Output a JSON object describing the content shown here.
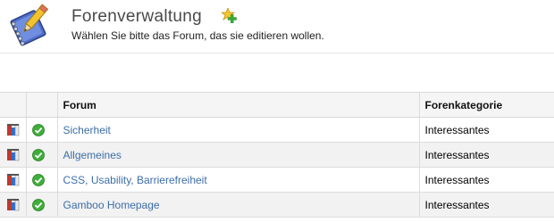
{
  "header": {
    "title": "Forenverwaltung",
    "subtitle": "Wählen Sie bitte das Forum, das sie editieren wollen."
  },
  "table": {
    "columns": [
      "",
      "",
      "Forum",
      "Forenkategorie"
    ],
    "rows": [
      {
        "forum": "Sicherheit",
        "category": "Interessantes",
        "status": "active"
      },
      {
        "forum": "Allgemeines",
        "category": "Interessantes",
        "status": "active"
      },
      {
        "forum": "CSS, Usability, Barrierefreiheit",
        "category": "Interessantes",
        "status": "active"
      },
      {
        "forum": "Gamboo Homepage",
        "category": "Interessantes",
        "status": "active"
      }
    ]
  },
  "icons": {
    "logo": "forum-settings-icon",
    "add": "add-forum-icon",
    "edit": "edit-tools-icon",
    "status": "check-circle-icon"
  },
  "colors": {
    "link": "#3c6ea8",
    "status_green": "#3fae3a",
    "header_bg": "#f5f5f5",
    "row_alt": "#f2f2f2"
  }
}
